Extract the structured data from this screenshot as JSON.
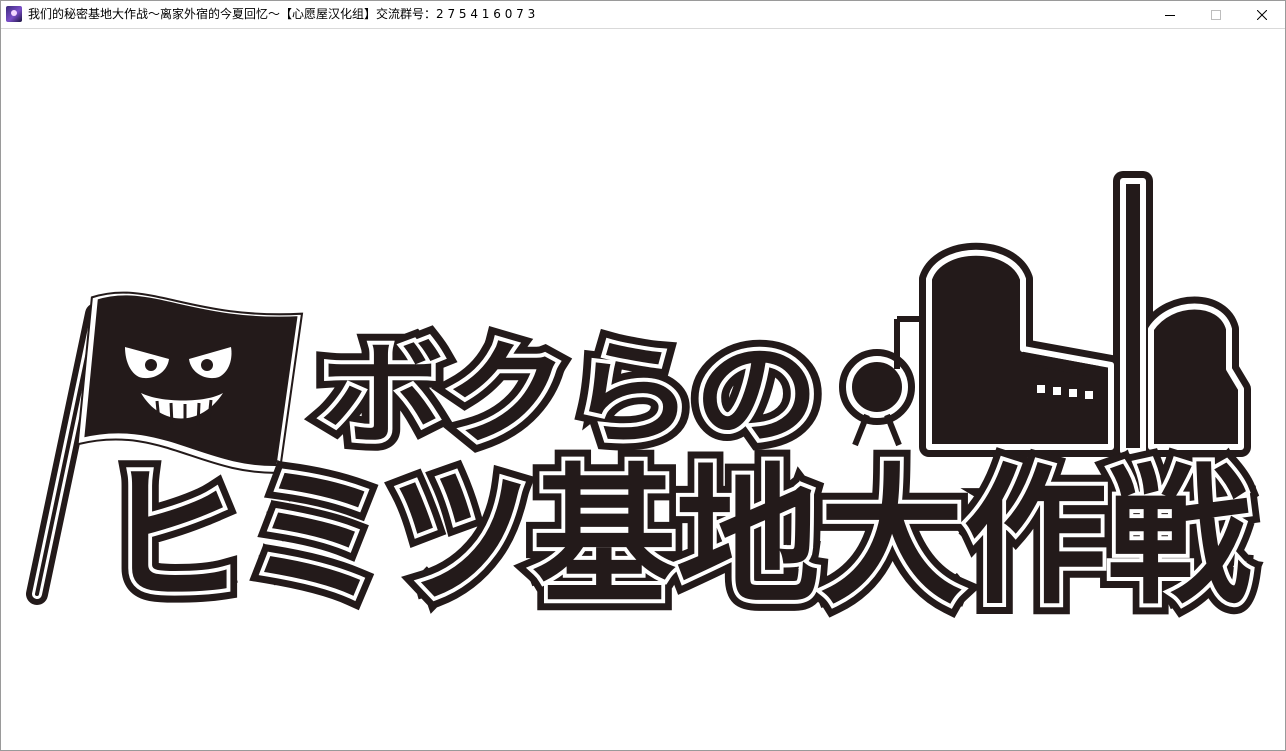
{
  "window": {
    "title": "我们的秘密基地大作战～离家外宿的今夏回忆～【心愿屋汉化组】交流群号：2 7 5 4 1 6 0 7 3",
    "icon": "app-icon"
  },
  "controls": {
    "minimize_icon": "minimize-icon",
    "maximize_icon": "maximize-icon",
    "close_icon": "close-icon"
  },
  "logo": {
    "line1": "ボクらの",
    "line2": "ヒミツ基地大作戦",
    "color": "#231a1a"
  }
}
